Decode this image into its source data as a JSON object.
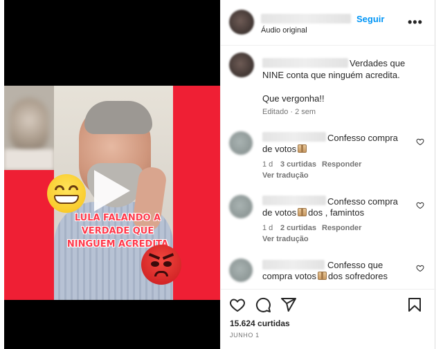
{
  "video": {
    "caption": "LULA FALANDO A VERDADE QUE NINGUEM ACREDITA"
  },
  "post_header": {
    "follow_label": "Seguir",
    "audio_label": "Áudio original",
    "more_icon": "more-icon"
  },
  "caption_comment": {
    "text_line1": "Verdades que",
    "text_line2": "NINE conta que ninguém acredita.",
    "text_line3": "Que vergonha!!",
    "meta": "Editado · 2 sem"
  },
  "comments": [
    {
      "text_a": "Confesso compra",
      "text_b_pre": "de votos",
      "text_b_post": "",
      "time": "1 d",
      "likes": "3 curtidas",
      "reply_label": "Responder",
      "translate_label": "Ver tradução"
    },
    {
      "text_a": "Confesso compra",
      "text_b_pre": "de votos",
      "text_b_post": "dos , famintos",
      "time": "1 d",
      "likes": "2 curtidas",
      "reply_label": "Responder",
      "translate_label": "Ver tradução"
    },
    {
      "text_a": "Confesso que",
      "text_b_pre": "compra votos",
      "text_b_post": "dos sofredores"
    }
  ],
  "actions": {
    "likes_count": "15.624 curtidas",
    "date": "JUNHO 1"
  },
  "icons": [
    "heart-icon",
    "comment-icon",
    "share-icon",
    "bookmark-icon",
    "play-icon",
    "package-emoji-icon"
  ],
  "colors": {
    "accent": "#0095f6",
    "frame_red": "#ef1f34",
    "caption_red": "#ff3a4c"
  }
}
